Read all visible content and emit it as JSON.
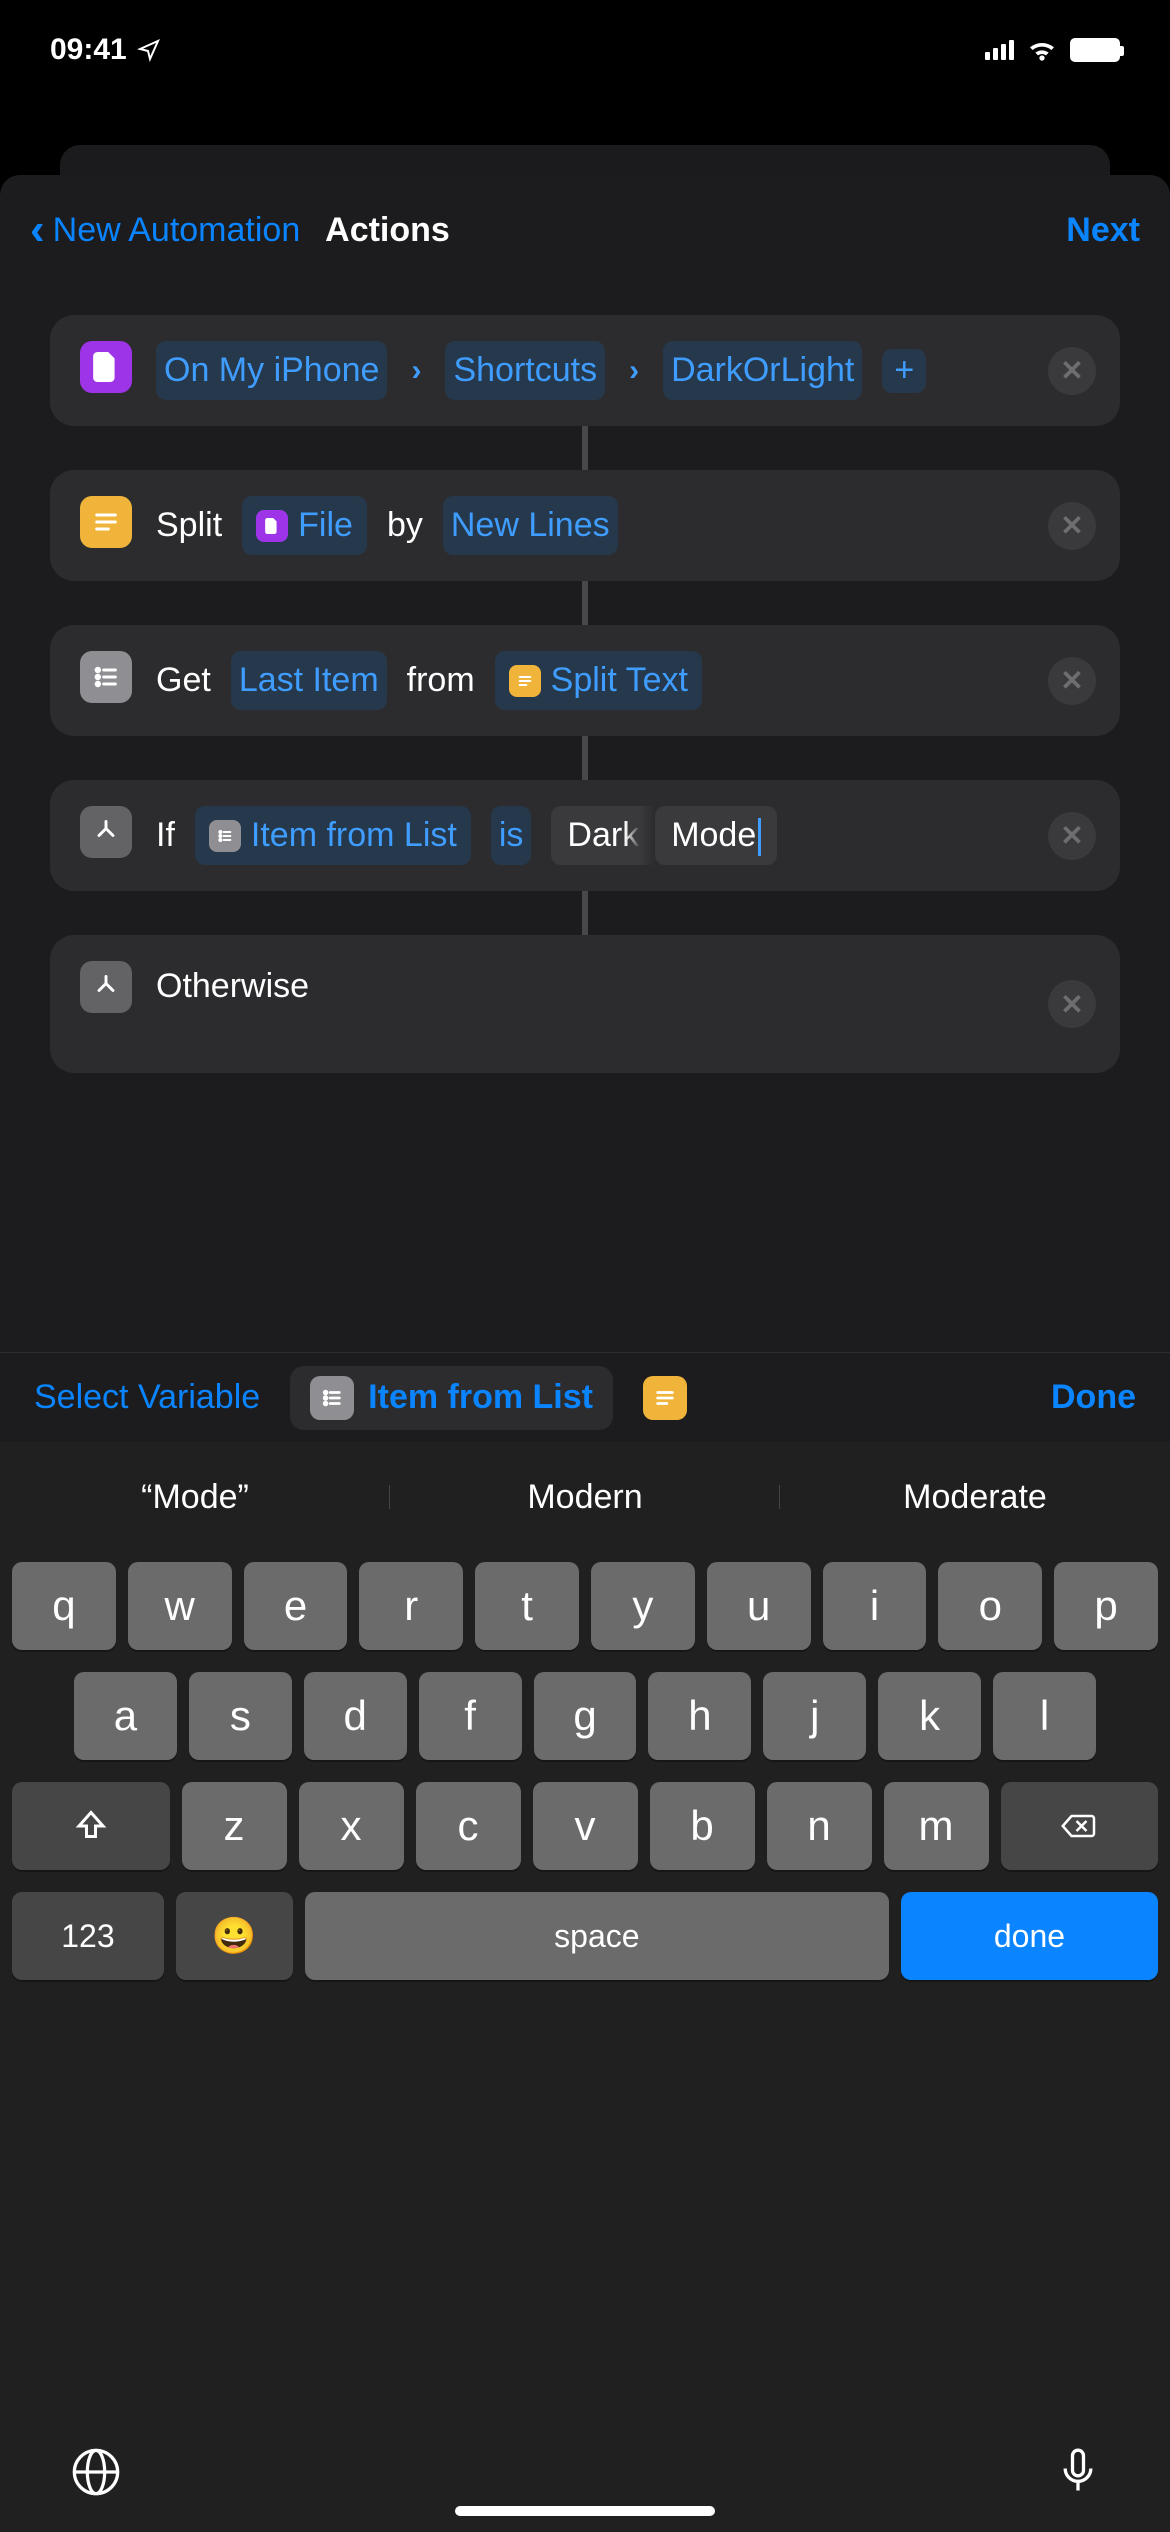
{
  "status": {
    "time": "09:41"
  },
  "nav": {
    "back": "New Automation",
    "title": "Actions",
    "next": "Next"
  },
  "cards": {
    "path": {
      "seg1": "On My iPhone",
      "seg2": "Shortcuts",
      "seg3": "DarkOrLight"
    },
    "split": {
      "verb": "Split",
      "obj": "File",
      "by": "by",
      "mode": "New Lines"
    },
    "get": {
      "verb": "Get",
      "sel": "Last Item",
      "from": "from",
      "src": "Split Text"
    },
    "if": {
      "verb": "If",
      "var": "Item from List",
      "op": "is",
      "val1": "Dark",
      "val2": "Mode"
    },
    "otherwise": {
      "label": "Otherwise"
    }
  },
  "accessory": {
    "select": "Select Variable",
    "var": "Item from List",
    "done": "Done"
  },
  "keyboard": {
    "suggestions": [
      "“Mode”",
      "Modern",
      "Moderate"
    ],
    "row1": [
      "q",
      "w",
      "e",
      "r",
      "t",
      "y",
      "u",
      "i",
      "o",
      "p"
    ],
    "row2": [
      "a",
      "s",
      "d",
      "f",
      "g",
      "h",
      "j",
      "k",
      "l"
    ],
    "row3": [
      "z",
      "x",
      "c",
      "v",
      "b",
      "n",
      "m"
    ],
    "numKey": "123",
    "space": "space",
    "done": "done"
  }
}
